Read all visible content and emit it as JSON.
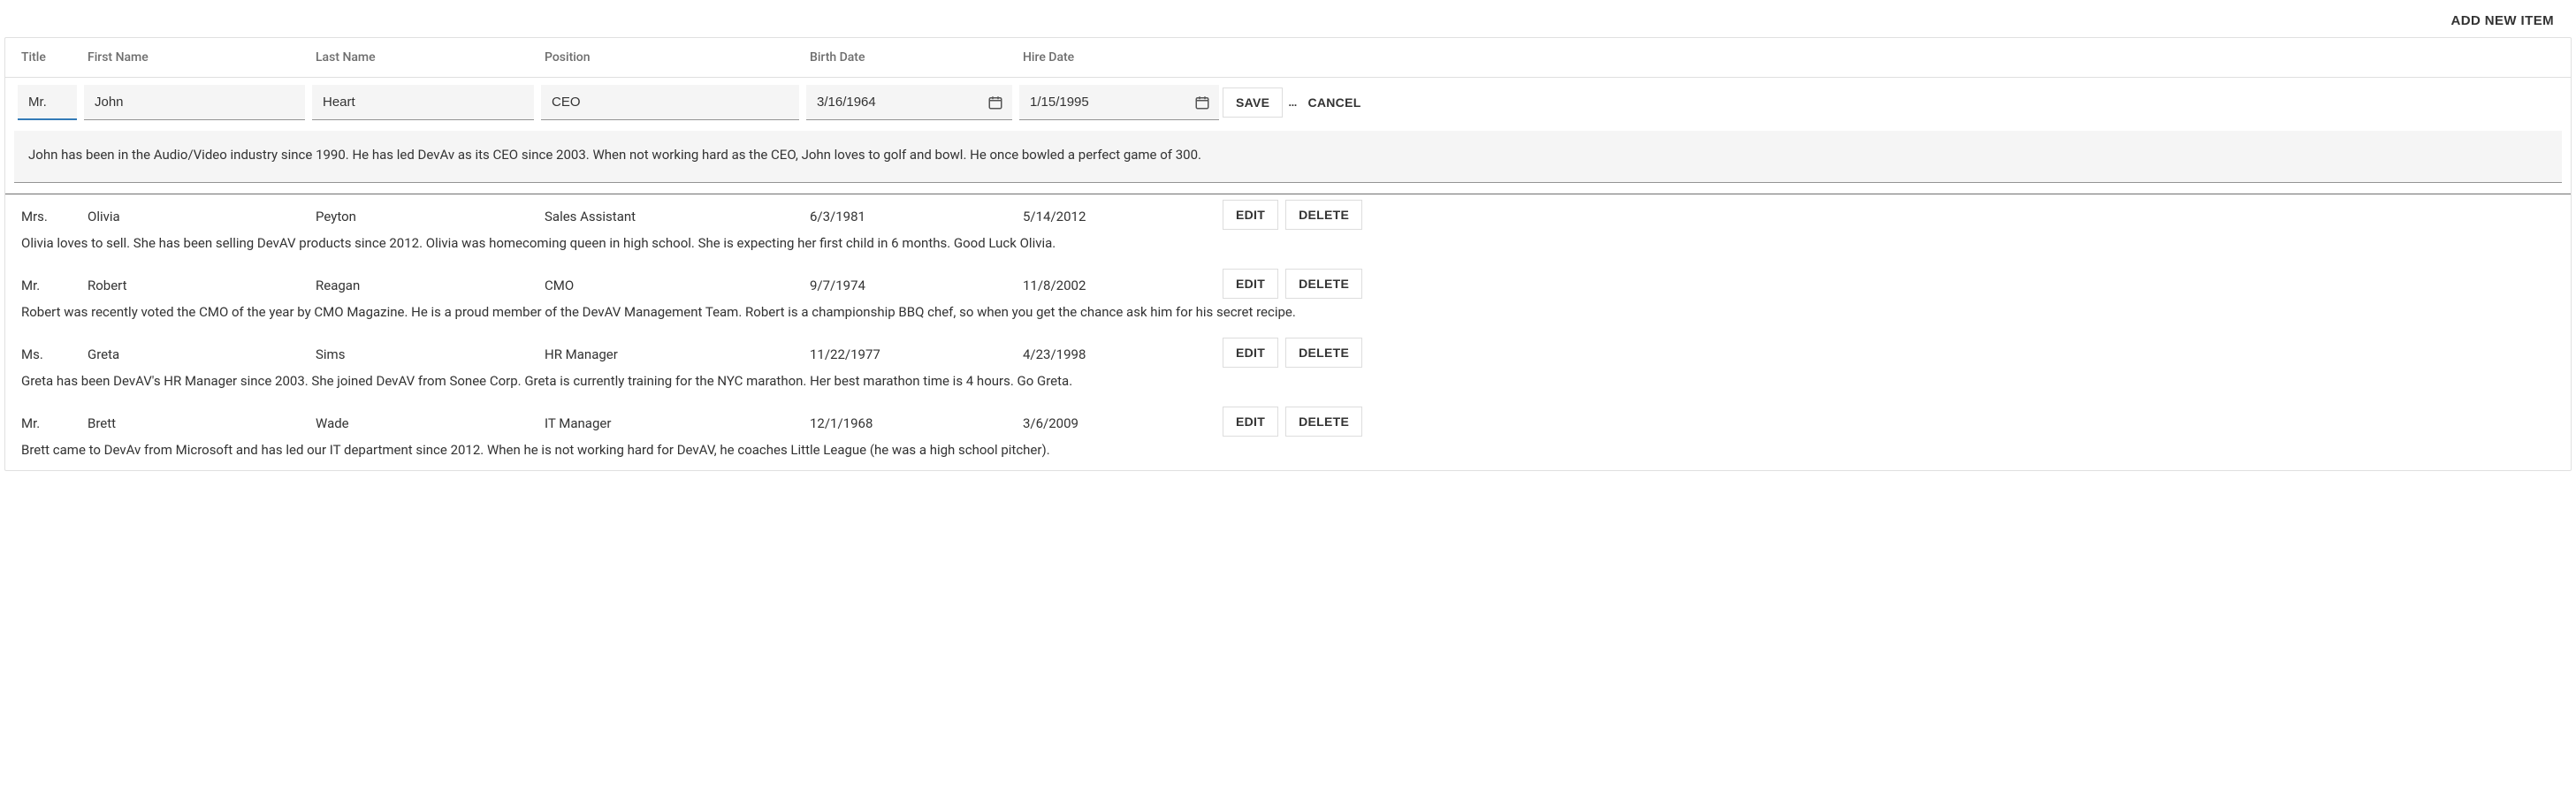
{
  "top": {
    "add_new_item": "ADD NEW ITEM"
  },
  "columns": {
    "title": "Title",
    "first_name": "First Name",
    "last_name": "Last Name",
    "position": "Position",
    "birth_date": "Birth Date",
    "hire_date": "Hire Date"
  },
  "edit": {
    "title": "Mr.",
    "first_name": "John",
    "last_name": "Heart",
    "position": "CEO",
    "birth_date": "3/16/1964",
    "hire_date": "1/15/1995",
    "notes": "John has been in the Audio/Video industry since 1990. He has led DevAv as its CEO since 2003. When not working hard as the CEO, John loves to golf and bowl. He once bowled a perfect game of 300.",
    "save_label": "SAVE",
    "cancel_label": "CANCEL",
    "more_label": "…"
  },
  "rows": [
    {
      "title": "Mrs.",
      "first_name": "Olivia",
      "last_name": "Peyton",
      "position": "Sales Assistant",
      "birth_date": "6/3/1981",
      "hire_date": "5/14/2012",
      "notes": "Olivia loves to sell. She has been selling DevAV products since 2012. Olivia was homecoming queen in high school. She is expecting her first child in 6 months. Good Luck Olivia."
    },
    {
      "title": "Mr.",
      "first_name": "Robert",
      "last_name": "Reagan",
      "position": "CMO",
      "birth_date": "9/7/1974",
      "hire_date": "11/8/2002",
      "notes": "Robert was recently voted the CMO of the year by CMO Magazine. He is a proud member of the DevAV Management Team. Robert is a championship BBQ chef, so when you get the chance ask him for his secret recipe."
    },
    {
      "title": "Ms.",
      "first_name": "Greta",
      "last_name": "Sims",
      "position": "HR Manager",
      "birth_date": "11/22/1977",
      "hire_date": "4/23/1998",
      "notes": "Greta has been DevAV's HR Manager since 2003. She joined DevAV from Sonee Corp. Greta is currently training for the NYC marathon. Her best marathon time is 4 hours. Go Greta."
    },
    {
      "title": "Mr.",
      "first_name": "Brett",
      "last_name": "Wade",
      "position": "IT Manager",
      "birth_date": "12/1/1968",
      "hire_date": "3/6/2009",
      "notes": "Brett came to DevAv from Microsoft and has led our IT department since 2012. When he is not working hard for DevAV, he coaches Little League (he was a high school pitcher)."
    }
  ],
  "row_actions": {
    "edit_label": "EDIT",
    "delete_label": "DELETE"
  }
}
